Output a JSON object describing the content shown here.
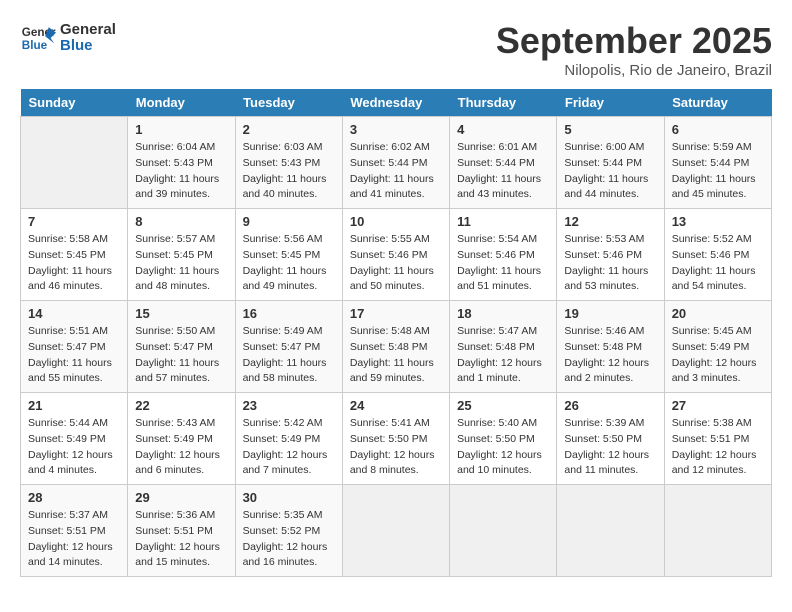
{
  "header": {
    "logo_line1": "General",
    "logo_line2": "Blue",
    "month": "September 2025",
    "location": "Nilopolis, Rio de Janeiro, Brazil"
  },
  "days_of_week": [
    "Sunday",
    "Monday",
    "Tuesday",
    "Wednesday",
    "Thursday",
    "Friday",
    "Saturday"
  ],
  "weeks": [
    [
      {
        "day": "",
        "info": ""
      },
      {
        "day": "1",
        "info": "Sunrise: 6:04 AM\nSunset: 5:43 PM\nDaylight: 11 hours\nand 39 minutes."
      },
      {
        "day": "2",
        "info": "Sunrise: 6:03 AM\nSunset: 5:43 PM\nDaylight: 11 hours\nand 40 minutes."
      },
      {
        "day": "3",
        "info": "Sunrise: 6:02 AM\nSunset: 5:44 PM\nDaylight: 11 hours\nand 41 minutes."
      },
      {
        "day": "4",
        "info": "Sunrise: 6:01 AM\nSunset: 5:44 PM\nDaylight: 11 hours\nand 43 minutes."
      },
      {
        "day": "5",
        "info": "Sunrise: 6:00 AM\nSunset: 5:44 PM\nDaylight: 11 hours\nand 44 minutes."
      },
      {
        "day": "6",
        "info": "Sunrise: 5:59 AM\nSunset: 5:44 PM\nDaylight: 11 hours\nand 45 minutes."
      }
    ],
    [
      {
        "day": "7",
        "info": "Sunrise: 5:58 AM\nSunset: 5:45 PM\nDaylight: 11 hours\nand 46 minutes."
      },
      {
        "day": "8",
        "info": "Sunrise: 5:57 AM\nSunset: 5:45 PM\nDaylight: 11 hours\nand 48 minutes."
      },
      {
        "day": "9",
        "info": "Sunrise: 5:56 AM\nSunset: 5:45 PM\nDaylight: 11 hours\nand 49 minutes."
      },
      {
        "day": "10",
        "info": "Sunrise: 5:55 AM\nSunset: 5:46 PM\nDaylight: 11 hours\nand 50 minutes."
      },
      {
        "day": "11",
        "info": "Sunrise: 5:54 AM\nSunset: 5:46 PM\nDaylight: 11 hours\nand 51 minutes."
      },
      {
        "day": "12",
        "info": "Sunrise: 5:53 AM\nSunset: 5:46 PM\nDaylight: 11 hours\nand 53 minutes."
      },
      {
        "day": "13",
        "info": "Sunrise: 5:52 AM\nSunset: 5:46 PM\nDaylight: 11 hours\nand 54 minutes."
      }
    ],
    [
      {
        "day": "14",
        "info": "Sunrise: 5:51 AM\nSunset: 5:47 PM\nDaylight: 11 hours\nand 55 minutes."
      },
      {
        "day": "15",
        "info": "Sunrise: 5:50 AM\nSunset: 5:47 PM\nDaylight: 11 hours\nand 57 minutes."
      },
      {
        "day": "16",
        "info": "Sunrise: 5:49 AM\nSunset: 5:47 PM\nDaylight: 11 hours\nand 58 minutes."
      },
      {
        "day": "17",
        "info": "Sunrise: 5:48 AM\nSunset: 5:48 PM\nDaylight: 11 hours\nand 59 minutes."
      },
      {
        "day": "18",
        "info": "Sunrise: 5:47 AM\nSunset: 5:48 PM\nDaylight: 12 hours\nand 1 minute."
      },
      {
        "day": "19",
        "info": "Sunrise: 5:46 AM\nSunset: 5:48 PM\nDaylight: 12 hours\nand 2 minutes."
      },
      {
        "day": "20",
        "info": "Sunrise: 5:45 AM\nSunset: 5:49 PM\nDaylight: 12 hours\nand 3 minutes."
      }
    ],
    [
      {
        "day": "21",
        "info": "Sunrise: 5:44 AM\nSunset: 5:49 PM\nDaylight: 12 hours\nand 4 minutes."
      },
      {
        "day": "22",
        "info": "Sunrise: 5:43 AM\nSunset: 5:49 PM\nDaylight: 12 hours\nand 6 minutes."
      },
      {
        "day": "23",
        "info": "Sunrise: 5:42 AM\nSunset: 5:49 PM\nDaylight: 12 hours\nand 7 minutes."
      },
      {
        "day": "24",
        "info": "Sunrise: 5:41 AM\nSunset: 5:50 PM\nDaylight: 12 hours\nand 8 minutes."
      },
      {
        "day": "25",
        "info": "Sunrise: 5:40 AM\nSunset: 5:50 PM\nDaylight: 12 hours\nand 10 minutes."
      },
      {
        "day": "26",
        "info": "Sunrise: 5:39 AM\nSunset: 5:50 PM\nDaylight: 12 hours\nand 11 minutes."
      },
      {
        "day": "27",
        "info": "Sunrise: 5:38 AM\nSunset: 5:51 PM\nDaylight: 12 hours\nand 12 minutes."
      }
    ],
    [
      {
        "day": "28",
        "info": "Sunrise: 5:37 AM\nSunset: 5:51 PM\nDaylight: 12 hours\nand 14 minutes."
      },
      {
        "day": "29",
        "info": "Sunrise: 5:36 AM\nSunset: 5:51 PM\nDaylight: 12 hours\nand 15 minutes."
      },
      {
        "day": "30",
        "info": "Sunrise: 5:35 AM\nSunset: 5:52 PM\nDaylight: 12 hours\nand 16 minutes."
      },
      {
        "day": "",
        "info": ""
      },
      {
        "day": "",
        "info": ""
      },
      {
        "day": "",
        "info": ""
      },
      {
        "day": "",
        "info": ""
      }
    ]
  ]
}
